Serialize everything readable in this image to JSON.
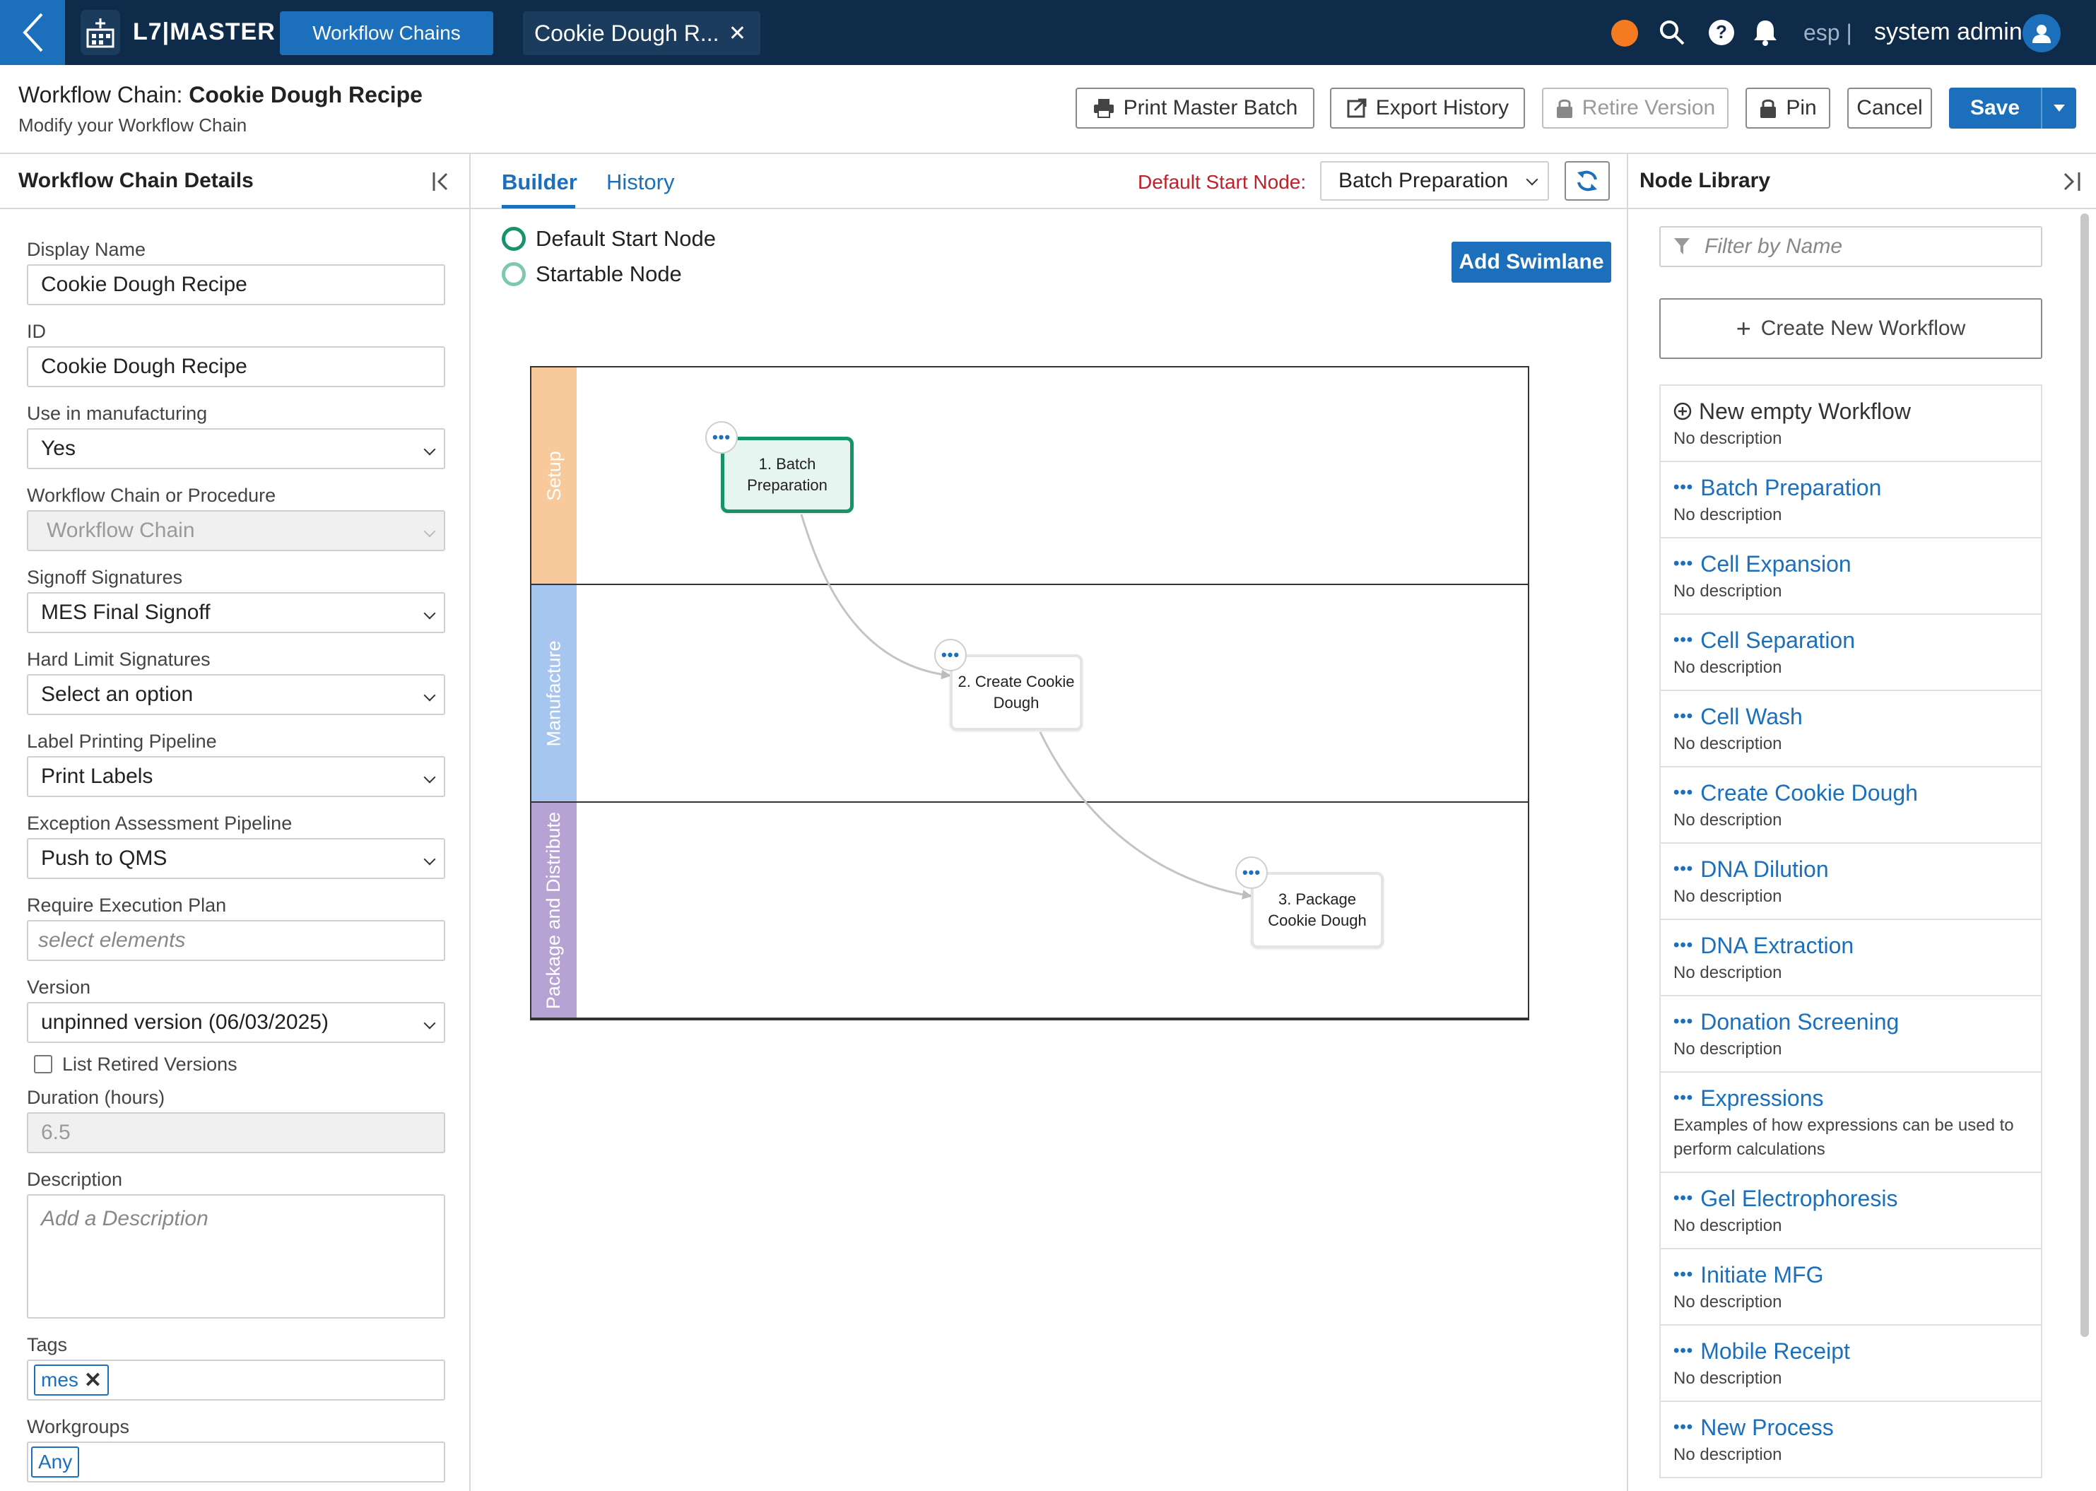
{
  "topbar": {
    "brand": "L7|MASTER",
    "primary_tab": "Workflow Chains",
    "doc_tab": "Cookie Dough R...",
    "lang": "esp |",
    "user": "system admin",
    "status_color": "#f47b20",
    "icons": [
      "back-chevron-icon",
      "app-logo-icon",
      "close-icon",
      "search-icon",
      "help-icon",
      "bell-icon",
      "user-icon"
    ]
  },
  "header": {
    "title_prefix": "Workflow Chain: ",
    "title_name": "Cookie Dough Recipe",
    "subtitle": "Modify your Workflow Chain",
    "buttons": {
      "print": "Print Master Batch",
      "export": "Export History",
      "retire": "Retire Version",
      "pin": "Pin",
      "cancel": "Cancel",
      "save": "Save"
    }
  },
  "left_panel": {
    "title": "Workflow Chain Details",
    "fields": {
      "display_name": {
        "label": "Display Name",
        "value": "Cookie Dough Recipe"
      },
      "id": {
        "label": "ID",
        "value": "Cookie Dough Recipe"
      },
      "use_in_mfg": {
        "label": "Use in manufacturing",
        "value": "Yes"
      },
      "chain_or_procedure": {
        "label": "Workflow Chain or Procedure",
        "value": "Workflow Chain"
      },
      "signoff": {
        "label": "Signoff Signatures",
        "value": "MES Final Signoff"
      },
      "hard_limit": {
        "label": "Hard Limit Signatures",
        "value": "Select an option"
      },
      "label_printing": {
        "label": "Label Printing Pipeline",
        "value": "Print Labels"
      },
      "exception": {
        "label": "Exception Assessment Pipeline",
        "value": "Push to QMS"
      },
      "exec_plan": {
        "label": "Require Execution Plan",
        "placeholder": "select elements"
      },
      "version": {
        "label": "Version",
        "value": "unpinned version (06/03/2025)"
      },
      "list_retired": {
        "label": "List Retired Versions"
      },
      "duration": {
        "label": "Duration (hours)",
        "value": "6.5"
      },
      "description": {
        "label": "Description",
        "placeholder": "Add a Description"
      },
      "tags": {
        "label": "Tags",
        "value": "mes"
      },
      "workgroups": {
        "label": "Workgroups",
        "value": "Any"
      }
    }
  },
  "center": {
    "tabs": {
      "builder": "Builder",
      "history": "History"
    },
    "default_start_label": "Default Start Node:",
    "default_start_value": "Batch Preparation",
    "legend": {
      "default_start": "Default Start Node",
      "startable": "Startable Node"
    },
    "add_swimlane": "Add Swimlane",
    "lanes": [
      {
        "name": "Setup",
        "color": "#f7c99b"
      },
      {
        "name": "Manufacture",
        "color": "#a6c5ef"
      },
      {
        "name": "Package and Distribute",
        "color": "#b6a3d3"
      }
    ],
    "nodes": [
      {
        "label": "1. Batch Preparation"
      },
      {
        "label": "2. Create Cookie Dough"
      },
      {
        "label": "3. Package Cookie Dough"
      }
    ],
    "node_menu": "•••"
  },
  "right_panel": {
    "title": "Node Library",
    "filter_placeholder": "Filter by Name",
    "create_new": "Create New Workflow",
    "items": [
      {
        "title": "New empty Workflow",
        "desc": "No description"
      },
      {
        "title": "Batch Preparation",
        "desc": "No description"
      },
      {
        "title": "Cell Expansion",
        "desc": "No description"
      },
      {
        "title": "Cell Separation",
        "desc": "No description"
      },
      {
        "title": "Cell Wash",
        "desc": "No description"
      },
      {
        "title": "Create Cookie Dough",
        "desc": "No description"
      },
      {
        "title": "DNA Dilution",
        "desc": "No description"
      },
      {
        "title": "DNA Extraction",
        "desc": "No description"
      },
      {
        "title": "Donation Screening",
        "desc": "No description"
      },
      {
        "title": "Expressions",
        "desc": "Examples of how expressions can be used to perform calculations"
      },
      {
        "title": "Gel Electrophoresis",
        "desc": "No description"
      },
      {
        "title": "Initiate MFG",
        "desc": "No description"
      },
      {
        "title": "Mobile Receipt",
        "desc": "No description"
      },
      {
        "title": "New Process",
        "desc": "No description"
      }
    ],
    "dots": "•••"
  }
}
